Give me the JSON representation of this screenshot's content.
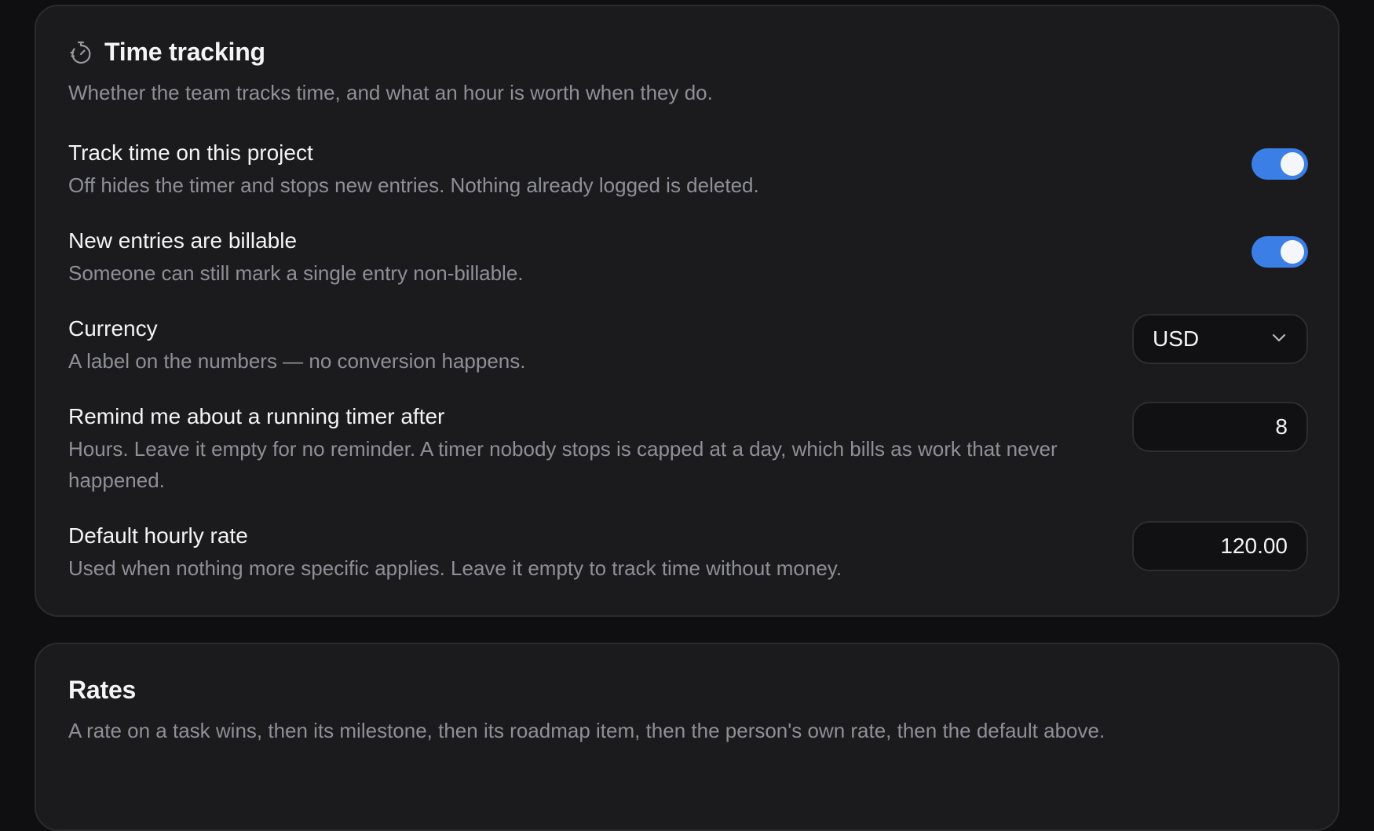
{
  "time_tracking": {
    "icon": "stopwatch-icon",
    "title": "Time tracking",
    "description": "Whether the team tracks time, and what an hour is worth when they do.",
    "settings": {
      "track_time": {
        "label": "Track time on this project",
        "help": "Off hides the timer and stops new entries. Nothing already logged is deleted.",
        "enabled": true
      },
      "billable": {
        "label": "New entries are billable",
        "help": "Someone can still mark a single entry non-billable.",
        "enabled": true
      },
      "currency": {
        "label": "Currency",
        "help": "A label on the numbers — no conversion happens.",
        "value": "USD"
      },
      "reminder": {
        "label": "Remind me about a running timer after",
        "help": "Hours. Leave it empty for no reminder. A timer nobody stops is capped at a day, which bills as work that never happened.",
        "value": "8"
      },
      "hourly_rate": {
        "label": "Default hourly rate",
        "help": "Used when nothing more specific applies. Leave it empty to track time without money.",
        "value": "120.00"
      }
    }
  },
  "rates": {
    "title": "Rates",
    "description": "A rate on a task wins, then its milestone, then its roadmap item, then the person's own rate, then the default above."
  },
  "colors": {
    "accent": "#3b7fe6",
    "card": "#1b1b1e",
    "muted_text": "#8f8f98"
  }
}
